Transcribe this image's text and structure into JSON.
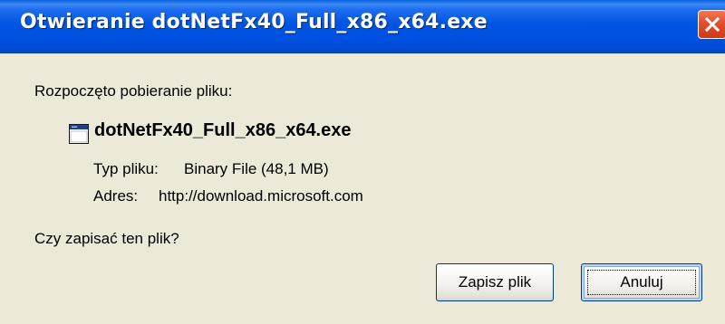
{
  "dialog": {
    "title": "Otwieranie dotNetFx40_Full_x86_x64.exe",
    "intro": "Rozpoczęto pobieranie pliku:",
    "file": {
      "name": "dotNetFx40_Full_x86_x64.exe",
      "icon": "application-window-icon",
      "type_label": "Typ pliku:",
      "type_value": "Binary File (48,1 MB)",
      "address_label": "Adres:",
      "address_value": "http://download.microsoft.com"
    },
    "question": "Czy zapisać ten plik?",
    "buttons": {
      "save": "Zapisz plik",
      "cancel": "Anuluj"
    }
  },
  "colors": {
    "titlebar": "#0054e3",
    "window_bg": "#ece9d8",
    "close_button": "#e2502a"
  }
}
